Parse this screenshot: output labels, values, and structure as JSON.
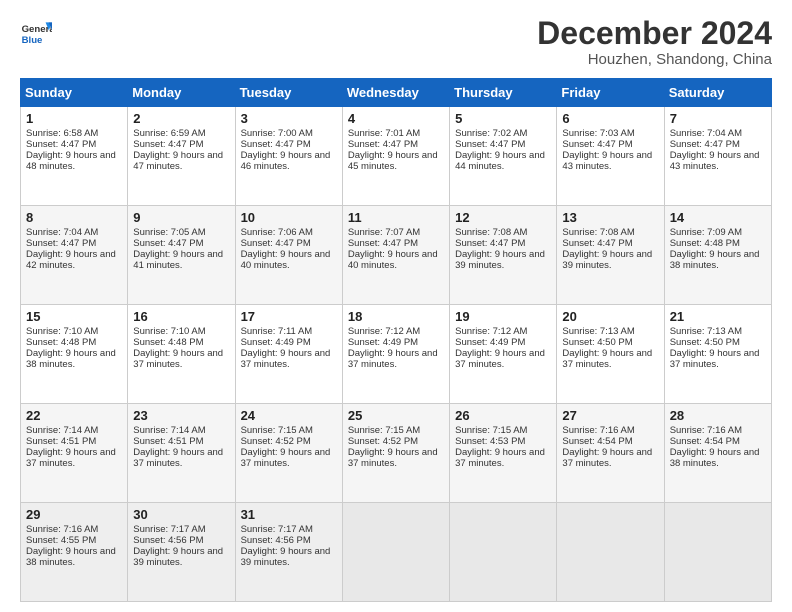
{
  "header": {
    "logo_general": "General",
    "logo_blue": "Blue",
    "month_year": "December 2024",
    "location": "Houzhen, Shandong, China"
  },
  "weekdays": [
    "Sunday",
    "Monday",
    "Tuesday",
    "Wednesday",
    "Thursday",
    "Friday",
    "Saturday"
  ],
  "weeks": [
    [
      {
        "day": "1",
        "sunrise": "6:58 AM",
        "sunset": "4:47 PM",
        "daylight": "9 hours and 48 minutes."
      },
      {
        "day": "2",
        "sunrise": "6:59 AM",
        "sunset": "4:47 PM",
        "daylight": "9 hours and 47 minutes."
      },
      {
        "day": "3",
        "sunrise": "7:00 AM",
        "sunset": "4:47 PM",
        "daylight": "9 hours and 46 minutes."
      },
      {
        "day": "4",
        "sunrise": "7:01 AM",
        "sunset": "4:47 PM",
        "daylight": "9 hours and 45 minutes."
      },
      {
        "day": "5",
        "sunrise": "7:02 AM",
        "sunset": "4:47 PM",
        "daylight": "9 hours and 44 minutes."
      },
      {
        "day": "6",
        "sunrise": "7:03 AM",
        "sunset": "4:47 PM",
        "daylight": "9 hours and 43 minutes."
      },
      {
        "day": "7",
        "sunrise": "7:04 AM",
        "sunset": "4:47 PM",
        "daylight": "9 hours and 43 minutes."
      }
    ],
    [
      {
        "day": "8",
        "sunrise": "7:04 AM",
        "sunset": "4:47 PM",
        "daylight": "9 hours and 42 minutes."
      },
      {
        "day": "9",
        "sunrise": "7:05 AM",
        "sunset": "4:47 PM",
        "daylight": "9 hours and 41 minutes."
      },
      {
        "day": "10",
        "sunrise": "7:06 AM",
        "sunset": "4:47 PM",
        "daylight": "9 hours and 40 minutes."
      },
      {
        "day": "11",
        "sunrise": "7:07 AM",
        "sunset": "4:47 PM",
        "daylight": "9 hours and 40 minutes."
      },
      {
        "day": "12",
        "sunrise": "7:08 AM",
        "sunset": "4:47 PM",
        "daylight": "9 hours and 39 minutes."
      },
      {
        "day": "13",
        "sunrise": "7:08 AM",
        "sunset": "4:47 PM",
        "daylight": "9 hours and 39 minutes."
      },
      {
        "day": "14",
        "sunrise": "7:09 AM",
        "sunset": "4:48 PM",
        "daylight": "9 hours and 38 minutes."
      }
    ],
    [
      {
        "day": "15",
        "sunrise": "7:10 AM",
        "sunset": "4:48 PM",
        "daylight": "9 hours and 38 minutes."
      },
      {
        "day": "16",
        "sunrise": "7:10 AM",
        "sunset": "4:48 PM",
        "daylight": "9 hours and 37 minutes."
      },
      {
        "day": "17",
        "sunrise": "7:11 AM",
        "sunset": "4:49 PM",
        "daylight": "9 hours and 37 minutes."
      },
      {
        "day": "18",
        "sunrise": "7:12 AM",
        "sunset": "4:49 PM",
        "daylight": "9 hours and 37 minutes."
      },
      {
        "day": "19",
        "sunrise": "7:12 AM",
        "sunset": "4:49 PM",
        "daylight": "9 hours and 37 minutes."
      },
      {
        "day": "20",
        "sunrise": "7:13 AM",
        "sunset": "4:50 PM",
        "daylight": "9 hours and 37 minutes."
      },
      {
        "day": "21",
        "sunrise": "7:13 AM",
        "sunset": "4:50 PM",
        "daylight": "9 hours and 37 minutes."
      }
    ],
    [
      {
        "day": "22",
        "sunrise": "7:14 AM",
        "sunset": "4:51 PM",
        "daylight": "9 hours and 37 minutes."
      },
      {
        "day": "23",
        "sunrise": "7:14 AM",
        "sunset": "4:51 PM",
        "daylight": "9 hours and 37 minutes."
      },
      {
        "day": "24",
        "sunrise": "7:15 AM",
        "sunset": "4:52 PM",
        "daylight": "9 hours and 37 minutes."
      },
      {
        "day": "25",
        "sunrise": "7:15 AM",
        "sunset": "4:52 PM",
        "daylight": "9 hours and 37 minutes."
      },
      {
        "day": "26",
        "sunrise": "7:15 AM",
        "sunset": "4:53 PM",
        "daylight": "9 hours and 37 minutes."
      },
      {
        "day": "27",
        "sunrise": "7:16 AM",
        "sunset": "4:54 PM",
        "daylight": "9 hours and 37 minutes."
      },
      {
        "day": "28",
        "sunrise": "7:16 AM",
        "sunset": "4:54 PM",
        "daylight": "9 hours and 38 minutes."
      }
    ],
    [
      {
        "day": "29",
        "sunrise": "7:16 AM",
        "sunset": "4:55 PM",
        "daylight": "9 hours and 38 minutes."
      },
      {
        "day": "30",
        "sunrise": "7:17 AM",
        "sunset": "4:56 PM",
        "daylight": "9 hours and 39 minutes."
      },
      {
        "day": "31",
        "sunrise": "7:17 AM",
        "sunset": "4:56 PM",
        "daylight": "9 hours and 39 minutes."
      },
      null,
      null,
      null,
      null
    ]
  ]
}
